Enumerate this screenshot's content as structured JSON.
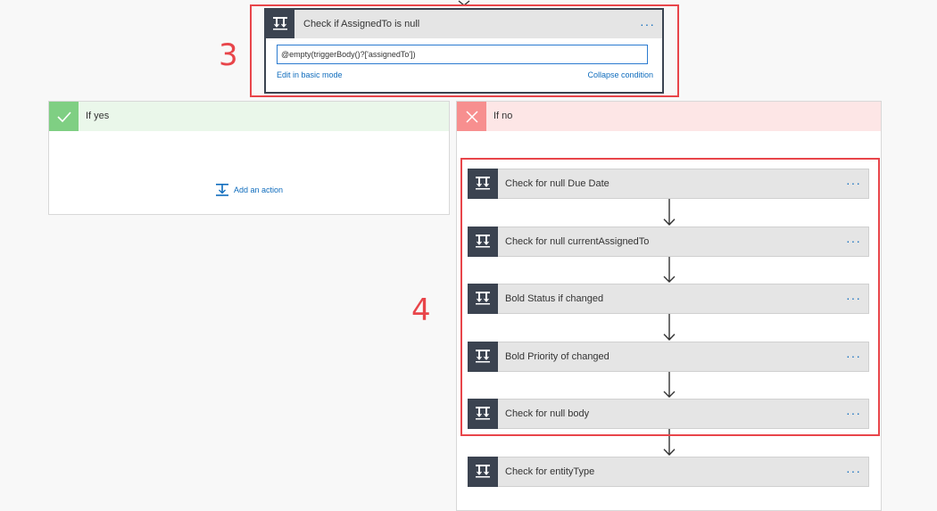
{
  "condition": {
    "title": "Check if AssignedTo is null",
    "expression": "@empty(triggerBody()?['assignedTo'])",
    "edit_link": "Edit in basic mode",
    "collapse_link": "Collapse condition",
    "menu": "···"
  },
  "annotations": {
    "label_3": "3",
    "label_4": "4"
  },
  "branch_yes": {
    "title": "If yes",
    "add_action": "Add an action"
  },
  "branch_no": {
    "title": "If no",
    "steps": [
      {
        "label": "Check for null Due Date",
        "menu": "···"
      },
      {
        "label": "Check for null currentAssignedTo",
        "menu": "···"
      },
      {
        "label": "Bold Status if changed",
        "menu": "···"
      },
      {
        "label": "Bold Priority of changed",
        "menu": "···"
      },
      {
        "label": "Check for null body",
        "menu": "···"
      },
      {
        "label": "Check for entityType",
        "menu": "···"
      }
    ]
  },
  "colors": {
    "annotation_red": "#e8454a",
    "yes_green": "#7fcf83",
    "no_red": "#f78f8f",
    "link_blue": "#0f6cbd",
    "icon_dark": "#3b4350"
  },
  "icons": {
    "condition": "condition-icon",
    "yes": "checkmark-icon",
    "no": "close-icon",
    "add": "add-action-icon",
    "arrow": "down-arrow-icon"
  }
}
